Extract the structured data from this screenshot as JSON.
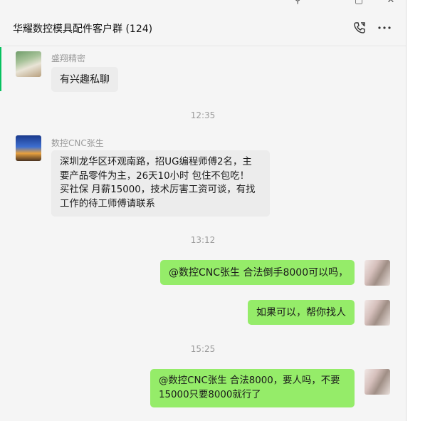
{
  "window": {
    "controls": [
      "⚲",
      "▢",
      "✕"
    ]
  },
  "header": {
    "title": "华耀数控模具配件客户群 (124)",
    "phone_icon": "phone-call-icon",
    "more_icon": "more-horizontal-icon"
  },
  "messages": {
    "m1": {
      "sender": "盛翔精密",
      "text": "有兴趣私聊"
    },
    "t1": "12:35",
    "m2": {
      "sender": "数控CNC张生",
      "lines": [
        "深圳龙华区环观南路，招UG编程师傅2名，主",
        "要产品零件为主，26天10小时 包住不包吃！",
        "买社保 月薪15000，技术厉害工资可谈，有找",
        "工作的待工师傅请联系"
      ]
    },
    "t2": "13:12",
    "m3": {
      "text": "@数控CNC张生 合法倒手8000可以吗，"
    },
    "m4": {
      "text": "如果可以，帮你找人"
    },
    "t3": "15:25",
    "m5": {
      "lines": [
        "@数控CNC张生 合法8000，要人吗，不要",
        "15000只要8000就行了"
      ]
    }
  },
  "colors": {
    "self_bubble": "#95ec69",
    "other_bubble": "#ececec",
    "accent": "#07c160"
  }
}
